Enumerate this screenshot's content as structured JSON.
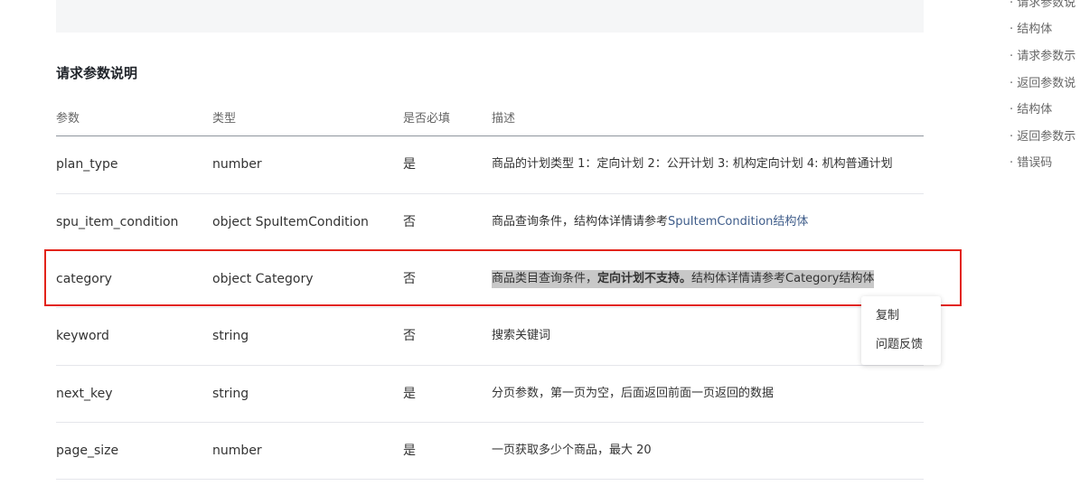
{
  "section_title": "请求参数说明",
  "table": {
    "headers": [
      "参数",
      "类型",
      "是否必填",
      "描述"
    ],
    "rows": [
      {
        "param": "plan_type",
        "type": "number",
        "required": "是",
        "desc": "商品的计划类型 1：定向计划 2：公开计划 3: 机构定向计划 4: 机构普通计划"
      },
      {
        "param": "spu_item_condition",
        "type": "object SpuItemCondition",
        "required": "否",
        "desc_prefix": "商品查询条件，结构体详情请参考",
        "desc_link": "SpuItemCondition结构体"
      },
      {
        "param": "category",
        "type": "object Category",
        "required": "否",
        "desc_part1": "商品类目查询条件，",
        "desc_bold": "定向计划不支持。",
        "desc_part2": "结构体详情请参考Category结构体"
      },
      {
        "param": "keyword",
        "type": "string",
        "required": "否",
        "desc": "搜索关键词"
      },
      {
        "param": "next_key",
        "type": "string",
        "required": "是",
        "desc": "分页参数，第一页为空，后面返回前面一页返回的数据"
      },
      {
        "param": "page_size",
        "type": "number",
        "required": "是",
        "desc": "一页获取多少个商品，最大 20"
      }
    ]
  },
  "context_menu": {
    "items": [
      "复制",
      "问题反馈"
    ]
  },
  "toc": {
    "items": [
      "· 请求参数说",
      "· 结构体",
      "· 请求参数示",
      "· 返回参数说",
      "· 结构体",
      "· 返回参数示",
      "· 错误码"
    ]
  }
}
